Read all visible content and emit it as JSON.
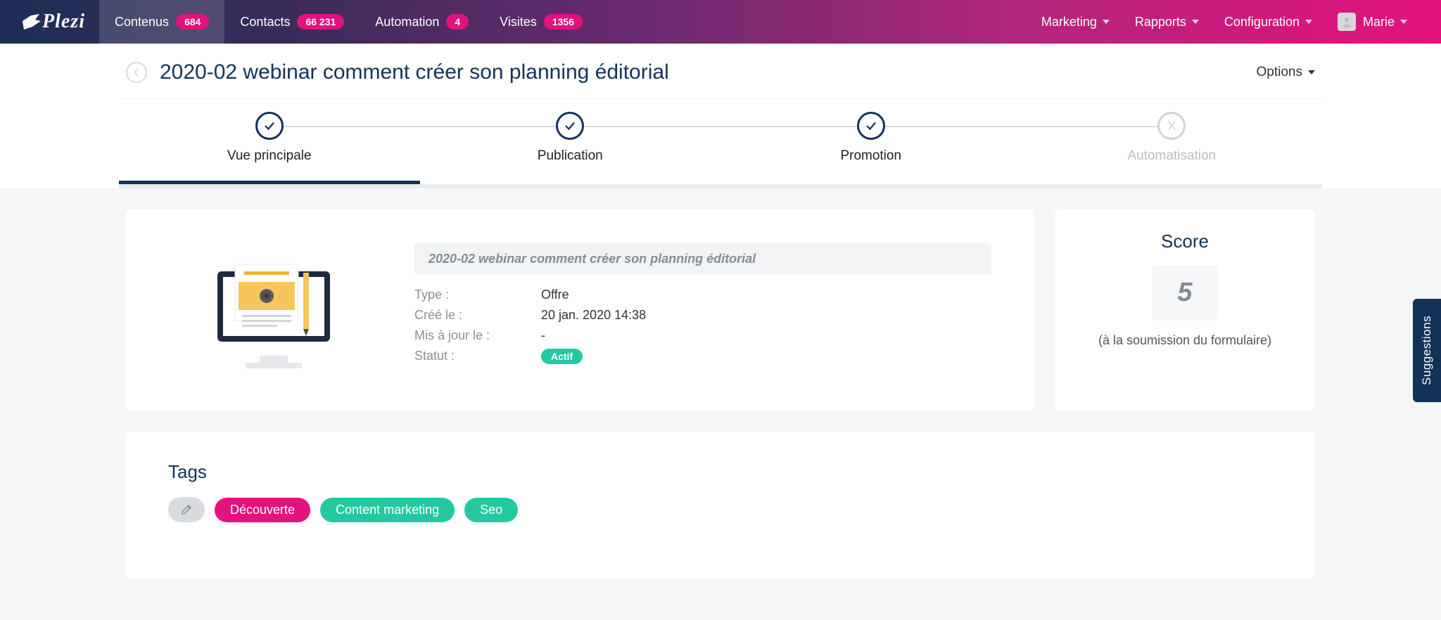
{
  "brand": "Plezi",
  "nav": {
    "left": [
      {
        "label": "Contenus",
        "badge": "684",
        "active": true
      },
      {
        "label": "Contacts",
        "badge": "66 231",
        "active": false
      },
      {
        "label": "Automation",
        "badge": "4",
        "active": false
      },
      {
        "label": "Visites",
        "badge": "1356",
        "active": false
      }
    ],
    "right": [
      {
        "label": "Marketing"
      },
      {
        "label": "Rapports"
      },
      {
        "label": "Configuration"
      }
    ],
    "user": "Marie"
  },
  "header": {
    "title": "2020-02 webinar comment créer son planning éditorial",
    "options_label": "Options"
  },
  "steps": [
    {
      "label": "Vue principale",
      "status": "done",
      "active": true
    },
    {
      "label": "Publication",
      "status": "done",
      "active": false
    },
    {
      "label": "Promotion",
      "status": "done",
      "active": false
    },
    {
      "label": "Automatisation",
      "status": "disabled",
      "active": false
    }
  ],
  "details": {
    "title": "2020-02 webinar comment créer son planning éditorial",
    "rows": {
      "type_label": "Type :",
      "type_value": "Offre",
      "created_label": "Créé le :",
      "created_value": "20 jan. 2020 14:38",
      "updated_label": "Mis à jour le :",
      "updated_value": "-",
      "status_label": "Statut :",
      "status_value": "Actif"
    }
  },
  "score": {
    "label": "Score",
    "value": "5",
    "note": "(à la soumission du formulaire)"
  },
  "tags": {
    "title": "Tags",
    "items": [
      {
        "label": "Découverte",
        "color": "pink"
      },
      {
        "label": "Content marketing",
        "color": "teal"
      },
      {
        "label": "Seo",
        "color": "teal"
      }
    ]
  },
  "suggestions_label": "Suggestions"
}
